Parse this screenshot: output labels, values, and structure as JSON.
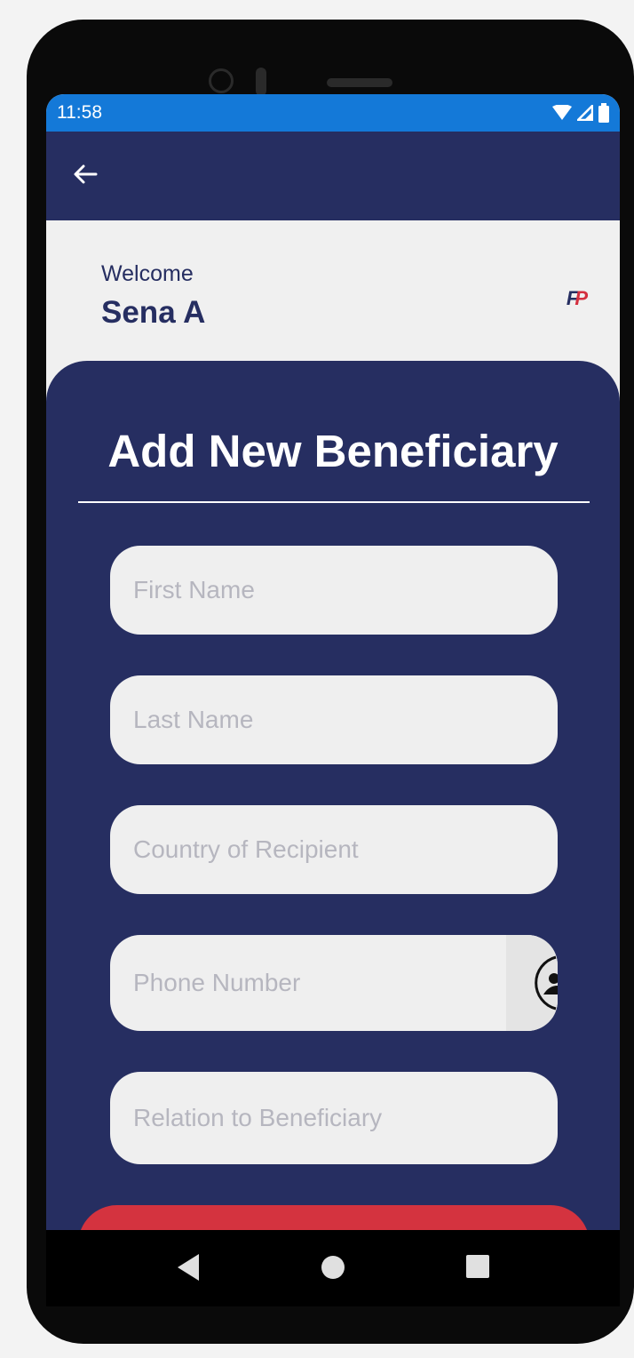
{
  "status_bar": {
    "time": "11:58",
    "icons": [
      "wifi-icon",
      "signal-icon",
      "battery-icon"
    ]
  },
  "app_bar": {
    "back_icon": "arrow-left-icon"
  },
  "header": {
    "welcome_label": "Welcome",
    "user_name": "Sena A",
    "logo": {
      "left": "F",
      "right": "P"
    }
  },
  "form": {
    "title": "Add New Beneficiary",
    "fields": [
      {
        "name": "first-name",
        "placeholder": "First Name",
        "value": ""
      },
      {
        "name": "last-name",
        "placeholder": "Last Name",
        "value": ""
      },
      {
        "name": "country-of-recipient",
        "placeholder": "Country of Recipient",
        "value": ""
      },
      {
        "name": "phone-number",
        "placeholder": "Phone Number",
        "value": "",
        "icon": "contact-picker-icon"
      },
      {
        "name": "relation-to-beneficiary",
        "placeholder": "Relation to Beneficiary",
        "value": ""
      }
    ]
  },
  "nav_bar": {
    "buttons": [
      "back-triangle-icon",
      "home-circle-icon",
      "recents-square-icon"
    ]
  },
  "colors": {
    "primary": "#262e61",
    "status_bar": "#1479d8",
    "accent": "#d4333f",
    "field_bg": "#efefef",
    "placeholder": "#b6b6bf"
  }
}
